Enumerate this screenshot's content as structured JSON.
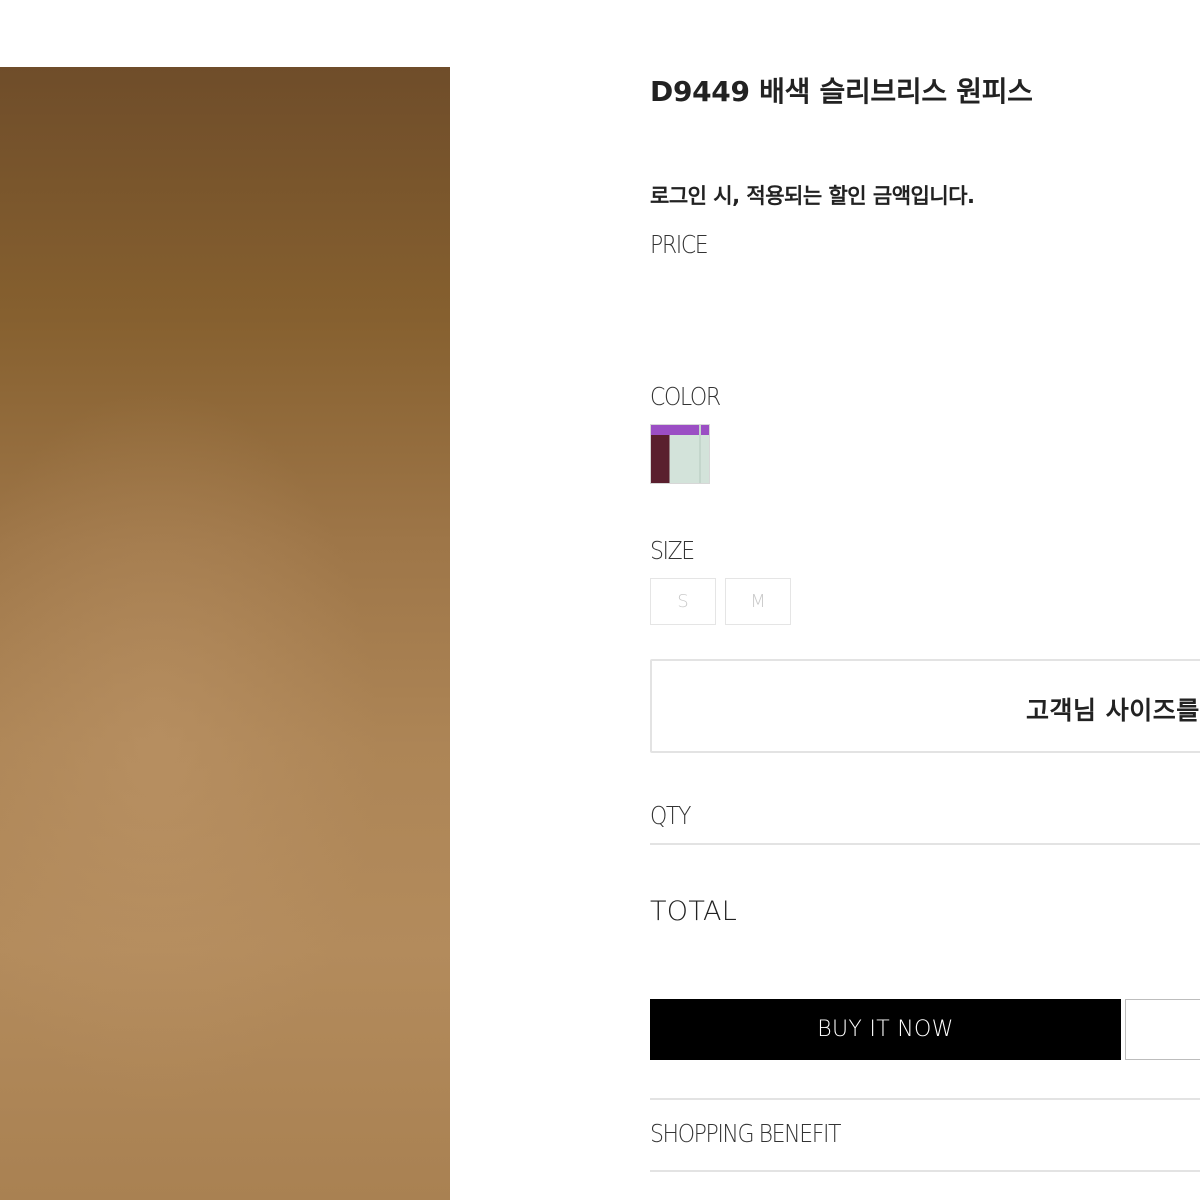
{
  "product": {
    "title": "D9449 배색 슬리브리스 원피스",
    "login_note": "로그인 시, 적용되는 할인 금액입니다."
  },
  "labels": {
    "price": "PRICE",
    "color": "COLOR",
    "size": "SIZE",
    "qty": "QTY",
    "total": "TOTAL",
    "shopping_benefit": "SHOPPING BENEFIT"
  },
  "sizes": [
    "S",
    "M"
  ],
  "size_finder": {
    "label": "고객님 사이즈를"
  },
  "actions": {
    "buy_now": "BUY IT NOW"
  },
  "colors": {
    "buy_button_bg": "#000000",
    "swatch_colors": [
      "#9b4ec4",
      "#5a1f2e",
      "#d3e3da"
    ],
    "image_tone": "#a97f50"
  }
}
